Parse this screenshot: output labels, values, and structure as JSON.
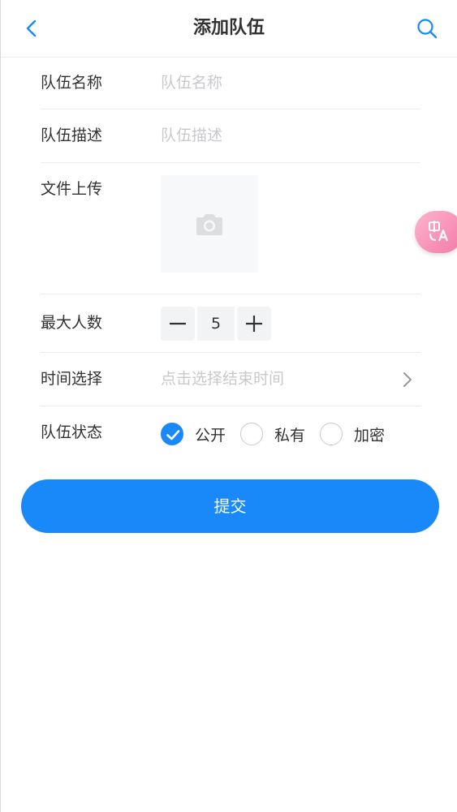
{
  "navbar": {
    "title": "添加队伍",
    "back_icon": "chevron-left-icon",
    "search_icon": "search-icon",
    "accent": "#1989fa"
  },
  "form": {
    "name": {
      "label": "队伍名称",
      "placeholder": "队伍名称",
      "value": ""
    },
    "description": {
      "label": "队伍描述",
      "placeholder": "队伍描述",
      "value": ""
    },
    "upload": {
      "label": "文件上传",
      "icon": "camera-icon"
    },
    "max_members": {
      "label": "最大人数",
      "value": "5",
      "decrement_icon": "minus-icon",
      "increment_icon": "plus-icon"
    },
    "time": {
      "label": "时间选择",
      "placeholder": "点击选择结束时间",
      "icon": "chevron-right-icon"
    },
    "status": {
      "label": "队伍状态",
      "options": [
        {
          "label": "公开",
          "checked": true
        },
        {
          "label": "私有",
          "checked": false
        },
        {
          "label": "加密",
          "checked": false
        }
      ]
    }
  },
  "submit": {
    "label": "提交",
    "color": "#1989fa"
  },
  "translate_badge": {
    "icon": "translate-icon"
  }
}
